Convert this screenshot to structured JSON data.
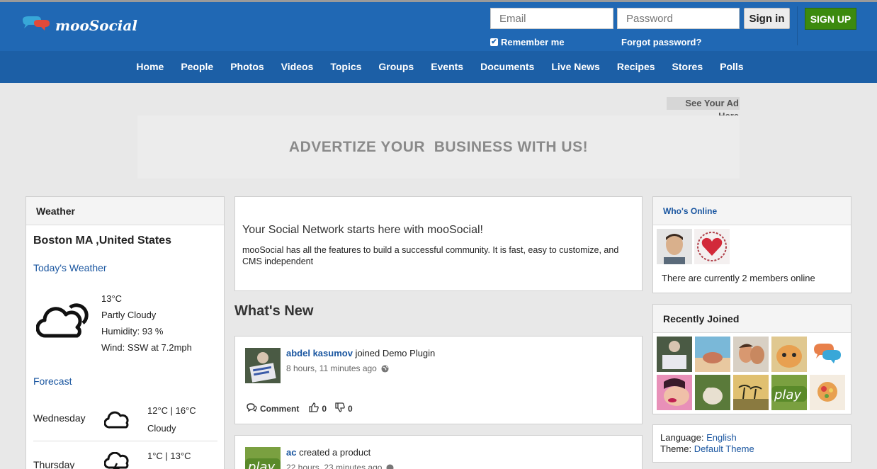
{
  "brand": {
    "name": "mooSocial"
  },
  "login": {
    "email_placeholder": "Email",
    "password_placeholder": "Password",
    "signin_label": "Sign in",
    "signup_label": "SIGN UP",
    "remember_label": "Remember me",
    "forgot_label": "Forgot password?"
  },
  "nav": {
    "items": [
      "Home",
      "People",
      "Photos",
      "Videos",
      "Topics",
      "Groups",
      "Events",
      "Documents",
      "Live News",
      "Recipes",
      "Stores",
      "Polls"
    ]
  },
  "ads": {
    "see_ad": "See Your Ad Here",
    "banner_text": "ADVERTIZE YOUR  BUSINESS WITH US!"
  },
  "weather": {
    "title": "Weather",
    "location": "Boston MA ,United States",
    "today_label": "Today's Weather",
    "temp": "13°C",
    "condition": "Partly Cloudy",
    "humidity": "Humidity: 93 %",
    "wind": "Wind: SSW at 7.2mph",
    "forecast_label": "Forecast",
    "forecast": [
      {
        "day": "Wednesday",
        "temps": "12°C | 16°C",
        "condition": "Cloudy"
      },
      {
        "day": "Thursday",
        "temps": "1°C | 13°C",
        "condition": ""
      }
    ]
  },
  "intro": {
    "title": "Your Social Network starts here with mooSocial!",
    "text": "mooSocial has all the features to build a successful community. It is fast, easy to customize, and CMS independent"
  },
  "whats_new": {
    "title": "What's New"
  },
  "feed": [
    {
      "user": "abdel kasumov",
      "action": " joined Demo Plugin",
      "time": "8 hours, 11 minutes ago",
      "comment_label": "Comment",
      "likes": "0",
      "dislikes": "0"
    },
    {
      "user": "ac",
      "action": " created a product",
      "time": "22 hours, 23 minutes ago"
    }
  ],
  "whos_online": {
    "title": "Who's Online",
    "text": "There are currently 2 members online"
  },
  "recently_joined": {
    "title": "Recently Joined"
  },
  "footer_box": {
    "language_label": "Language: ",
    "language": "English",
    "theme_label": "Theme: ",
    "theme": "Default Theme"
  },
  "colors": {
    "header": "#2068b4",
    "nav": "#1c5fa6",
    "signup": "#3c8a0e",
    "link": "#1a56a0"
  }
}
